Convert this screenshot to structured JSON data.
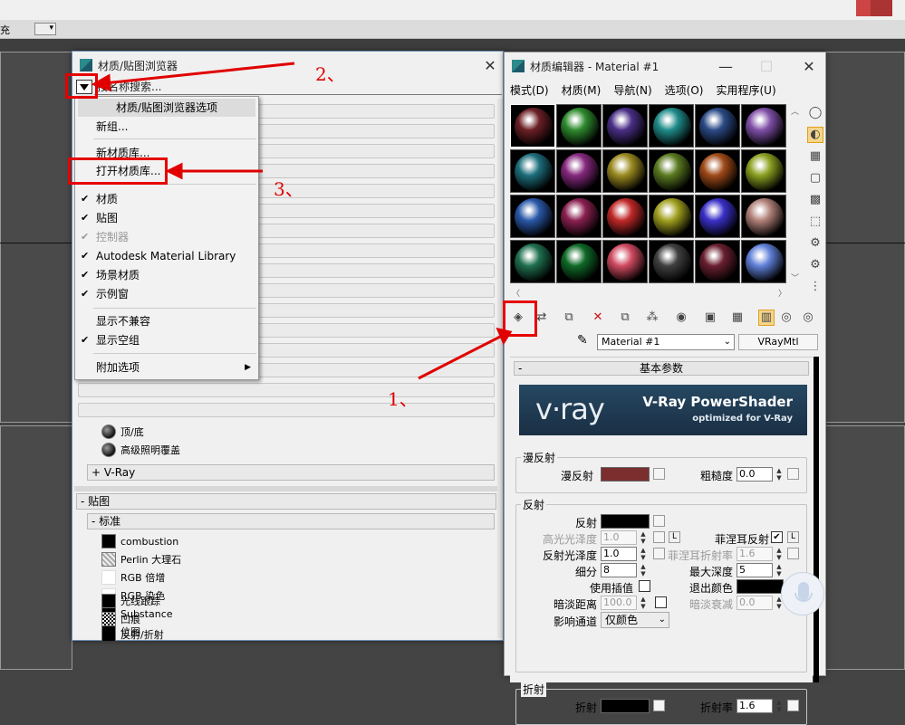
{
  "host": {
    "left_fragment": "充",
    "toolbar_dropdown": "▾"
  },
  "browser": {
    "title": "材质/贴图浏览器",
    "search_placeholder": "按名称搜索...",
    "items_visible": [
      {
        "label": "顶/底",
        "swatch": "round"
      },
      {
        "label": "高级照明覆盖",
        "swatch": "round"
      }
    ],
    "vray_section": "+ V-Ray",
    "maps_section": "- 贴图",
    "standard_section": "- 标准",
    "maps": [
      {
        "label": "combustion",
        "swatch": "black"
      },
      {
        "label": "Perlin 大理石",
        "swatch": "perlin"
      },
      {
        "label": "RGB 倍增",
        "swatch": "white"
      },
      {
        "label": "RGB 染色",
        "swatch": "white"
      },
      {
        "label": "Substance",
        "swatch": "black"
      },
      {
        "label": "位图",
        "swatch": "black"
      },
      {
        "label": "光线跟踪",
        "swatch": "black"
      },
      {
        "label": "凹痕",
        "swatch": "bump"
      },
      {
        "label": "反射/折射",
        "swatch": "black"
      }
    ]
  },
  "menu": {
    "header": "材质/贴图浏览器选项",
    "items": [
      {
        "label": "新组...",
        "checked": false,
        "disabled": false
      },
      {
        "label": "新材质库...",
        "checked": false,
        "disabled": false
      },
      {
        "label": "打开材质库...",
        "checked": false,
        "disabled": false
      },
      {
        "label": "材质",
        "checked": true,
        "disabled": false
      },
      {
        "label": "贴图",
        "checked": true,
        "disabled": false
      },
      {
        "label": "控制器",
        "checked": true,
        "disabled": true
      },
      {
        "label": "Autodesk Material Library",
        "checked": true,
        "disabled": false
      },
      {
        "label": "场景材质",
        "checked": true,
        "disabled": false
      },
      {
        "label": "示例窗",
        "checked": true,
        "disabled": false
      },
      {
        "label": "显示不兼容",
        "checked": false,
        "disabled": false
      },
      {
        "label": "显示空组",
        "checked": true,
        "disabled": false
      },
      {
        "label": "附加选项",
        "checked": false,
        "disabled": false,
        "submenu": "▶"
      }
    ]
  },
  "editor": {
    "title": "材质编辑器 - Material #1",
    "menubar": [
      "模式(D)",
      "材质(M)",
      "导航(N)",
      "选项(O)",
      "实用程序(U)"
    ],
    "spheres": [
      "#6b1f25",
      "#2e8a2e",
      "#4a2f86",
      "#1f8c8a",
      "#2b4a86",
      "#8050a8",
      "#1d6e7c",
      "#86287e",
      "#9a8a20",
      "#5a7a20",
      "#a04a18",
      "#8aa020",
      "#2a58a8",
      "#8a2050",
      "#c02828",
      "#a0a020",
      "#3a30c8",
      "#b08078",
      "#1f7050",
      "#0f6a28",
      "#d04a60",
      "#404040",
      "#6a2030",
      "#6080d8"
    ],
    "material_name": "Material #1",
    "material_type": "VRayMtl",
    "rollout_title": "基本参数",
    "vray_banner": {
      "logo": "v·ray",
      "headline": "V-Ray PowerShader",
      "sub": "optimized for V-Ray"
    },
    "diffuse": {
      "group": "漫反射",
      "label": "漫反射",
      "color": "#7a2e2e",
      "roughness_label": "粗糙度",
      "roughness": "0.0"
    },
    "reflection": {
      "group": "反射",
      "label": "反射",
      "hilight_label": "高光光泽度",
      "hilight": "1.0",
      "lock": "L",
      "fresnel_label": "菲涅耳反射",
      "fresnel_check": "✔",
      "fresnel_lock": "L",
      "gloss_label": "反射光泽度",
      "gloss": "1.0",
      "fresnel_ior_label": "菲涅耳折射率",
      "fresnel_ior": "1.6",
      "subdiv_label": "细分",
      "subdiv": "8",
      "maxdepth_label": "最大深度",
      "maxdepth": "5",
      "interp_label": "使用插值",
      "exit_label": "退出颜色",
      "dim_label": "暗淡距离",
      "dim": "100.0",
      "falloff_label": "暗淡衰减",
      "falloff": "0.0",
      "channel_label": "影响通道",
      "channel": "仅颜色"
    },
    "refraction": {
      "group": "折射",
      "label": "折射",
      "ior_label": "折射率",
      "ior": "1.6"
    }
  },
  "annotations": {
    "step1": "1、",
    "step2": "2、",
    "step3": "3、"
  }
}
